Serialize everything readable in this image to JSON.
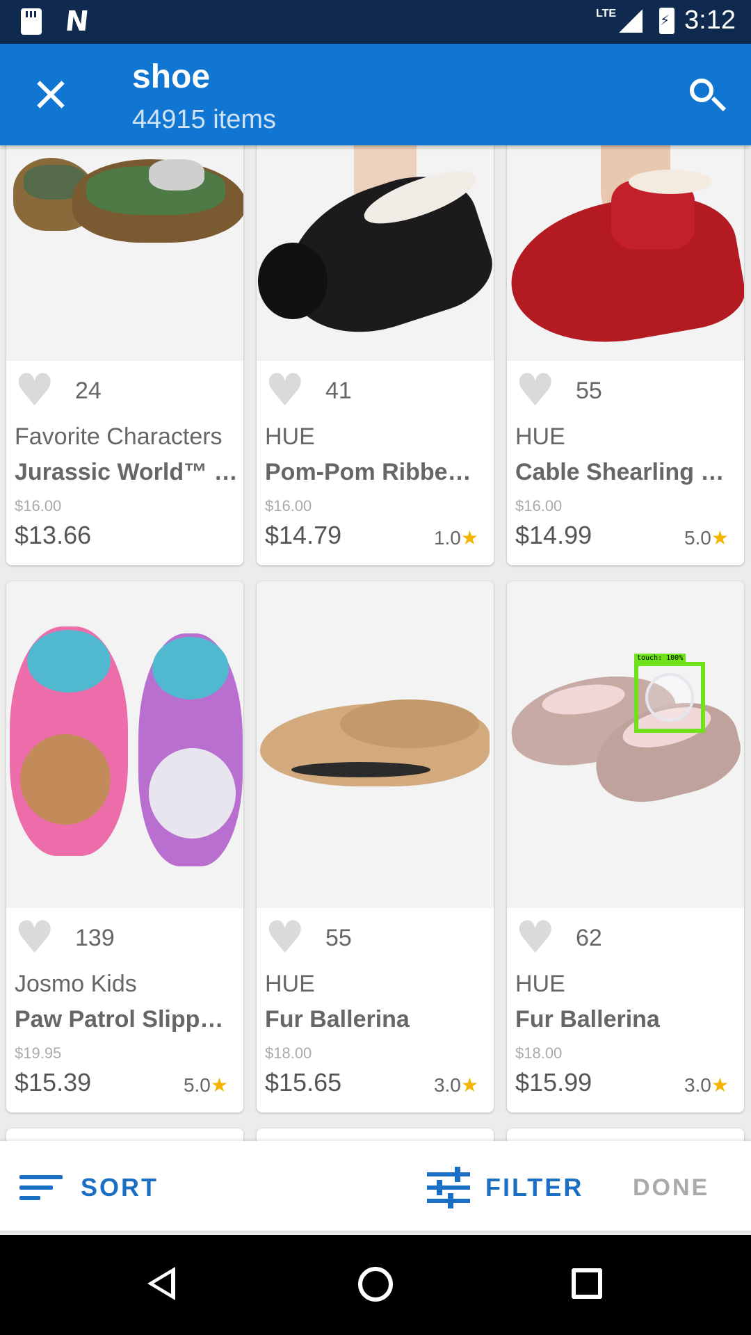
{
  "status_bar": {
    "time": "3:12",
    "network": "LTE"
  },
  "app_bar": {
    "title": "shoe",
    "subtitle": "44915 items"
  },
  "products": [
    {
      "likes": "24",
      "brand": "Favorite Characters",
      "name": "Jurassic World™ …",
      "original_price": "$16.00",
      "price": "$13.66",
      "rating": ""
    },
    {
      "likes": "41",
      "brand": "HUE",
      "name": "Pom-Pom Ribbe…",
      "original_price": "$16.00",
      "price": "$14.79",
      "rating": "1.0"
    },
    {
      "likes": "55",
      "brand": "HUE",
      "name": "Cable Shearling …",
      "original_price": "$16.00",
      "price": "$14.99",
      "rating": "5.0"
    },
    {
      "likes": "139",
      "brand": "Josmo Kids",
      "name": "Paw Patrol Slipp…",
      "original_price": "$19.95",
      "price": "$15.39",
      "rating": "5.0"
    },
    {
      "likes": "55",
      "brand": "HUE",
      "name": "Fur Ballerina",
      "original_price": "$18.00",
      "price": "$15.65",
      "rating": "3.0"
    },
    {
      "likes": "62",
      "brand": "HUE",
      "name": "Fur Ballerina",
      "original_price": "$18.00",
      "price": "$15.99",
      "rating": "3.0"
    }
  ],
  "touch_indicator": {
    "label": "touch: 100%"
  },
  "bottom_bar": {
    "sort_label": "SORT",
    "filter_label": "FILTER",
    "done_label": "DONE"
  },
  "colors": {
    "app_bar": "#1176d2",
    "status_bar": "#0f2a4e",
    "accent": "#1a6fc4",
    "star": "#f5b400",
    "touch": "#6fe21b"
  },
  "icons": [
    "sd-card-icon",
    "n-notification-icon",
    "signal-icon",
    "battery-charging-icon",
    "close-icon",
    "search-icon",
    "heart-icon",
    "star-icon",
    "sort-icon",
    "filter-icon",
    "back-icon",
    "home-icon",
    "recents-icon"
  ]
}
